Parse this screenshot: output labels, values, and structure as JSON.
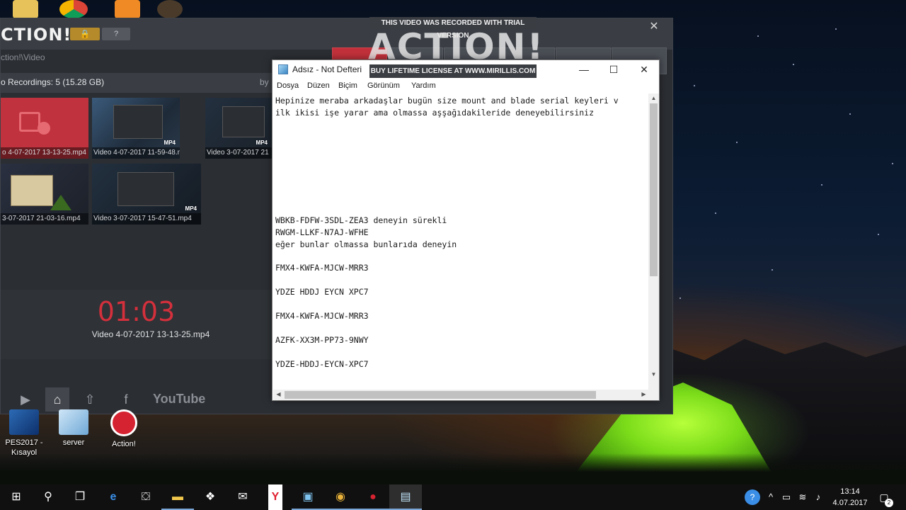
{
  "watermark": {
    "top": "THIS VIDEO WAS RECORDED WITH TRIAL VERSION",
    "logo": "ACTION!",
    "bottom": "BUY LIFETIME LICENSE AT WWW.MIRILLIS.COM"
  },
  "action_app": {
    "logo": "CTION!",
    "path": "ction!\\Video",
    "recordings_summary": "o Recordings: 5 (15.28 GB)",
    "sort_label": "by",
    "help_label": "?",
    "thumbnails": [
      {
        "label": "o 4-07-2017 13-13-25.mp4"
      },
      {
        "label": "Video 4-07-2017 11-59-48.mp4",
        "badge": "MP4"
      },
      {
        "label": "Video 3-07-2017 21",
        "badge": "MP4"
      },
      {
        "label": "3-07-2017 21-03-16.mp4"
      },
      {
        "label": "Video 3-07-2017 15-47-51.mp4",
        "badge": "MP4"
      }
    ],
    "timer": "01:03",
    "current_file": "Video 4-07-2017 13-13-25.mp4",
    "youtube_label": "YouTube"
  },
  "notepad": {
    "title": "Adsız - Not Defteri",
    "menu": [
      "Dosya",
      "Düzen",
      "Biçim",
      "Görünüm",
      "Yardım"
    ],
    "lines": [
      "Hepinize meraba arkadaşlar bugün size mount and blade serial keyleri v",
      "ilk ikisi işe yarar ama olmassa aşşağıdakileride deneyebilirsiniz",
      "",
      "",
      "",
      "",
      "",
      "",
      "",
      "",
      "WBKB-FDFW-3SDL-ZEA3 deneyin sürekli",
      "RWGM-LLKF-N7AJ-WFHE",
      "eğer bunlar olmassa bunlarıda deneyin",
      "",
      "FMX4-KWFA-MJCW-MRR3",
      "",
      "YDZE HDDJ EYCN XPC7",
      "",
      "FMX4-KWFA-MJCW-MRR3",
      "",
      "AZFK-XX3M-PP73-9NWY",
      "",
      "YDZE-HDDJ-EYCN-XPC7"
    ]
  },
  "desktop_icons": [
    {
      "name": "pes2017",
      "label": "PES2017 - Kısayol",
      "icon": "game-shortcut-icon"
    },
    {
      "name": "server",
      "label": "server",
      "icon": "server-icon"
    },
    {
      "name": "action",
      "label": "Action!",
      "icon": "action-record-icon"
    }
  ],
  "taskbar": {
    "items": [
      {
        "name": "start",
        "glyph": "⊞",
        "icon": "windows-icon"
      },
      {
        "name": "search",
        "glyph": "⚲",
        "icon": "search-icon"
      },
      {
        "name": "task-view",
        "glyph": "❐",
        "icon": "task-view-icon"
      },
      {
        "name": "edge",
        "glyph": "e",
        "icon": "edge-icon"
      },
      {
        "name": "store",
        "glyph": "⛋",
        "icon": "store-icon"
      },
      {
        "name": "explorer",
        "glyph": "▬",
        "icon": "folder-icon"
      },
      {
        "name": "dropbox",
        "glyph": "❖",
        "icon": "dropbox-icon"
      },
      {
        "name": "mail",
        "glyph": "✉",
        "icon": "mail-icon"
      },
      {
        "name": "yandex",
        "glyph": "Y",
        "icon": "yandex-icon"
      },
      {
        "name": "app",
        "glyph": "▣",
        "icon": "app-icon"
      },
      {
        "name": "chrome",
        "glyph": "◉",
        "icon": "chrome-icon"
      },
      {
        "name": "action",
        "glyph": "●",
        "icon": "action-record-icon"
      },
      {
        "name": "notepad",
        "glyph": "▤",
        "icon": "notepad-icon"
      }
    ],
    "time": "13:14",
    "date": "4.07.2017",
    "notification_count": "2"
  },
  "colors": {
    "accent_red": "#c2313b",
    "taskbar_bg": "#101010",
    "tent_green": "#7bdc1a"
  }
}
